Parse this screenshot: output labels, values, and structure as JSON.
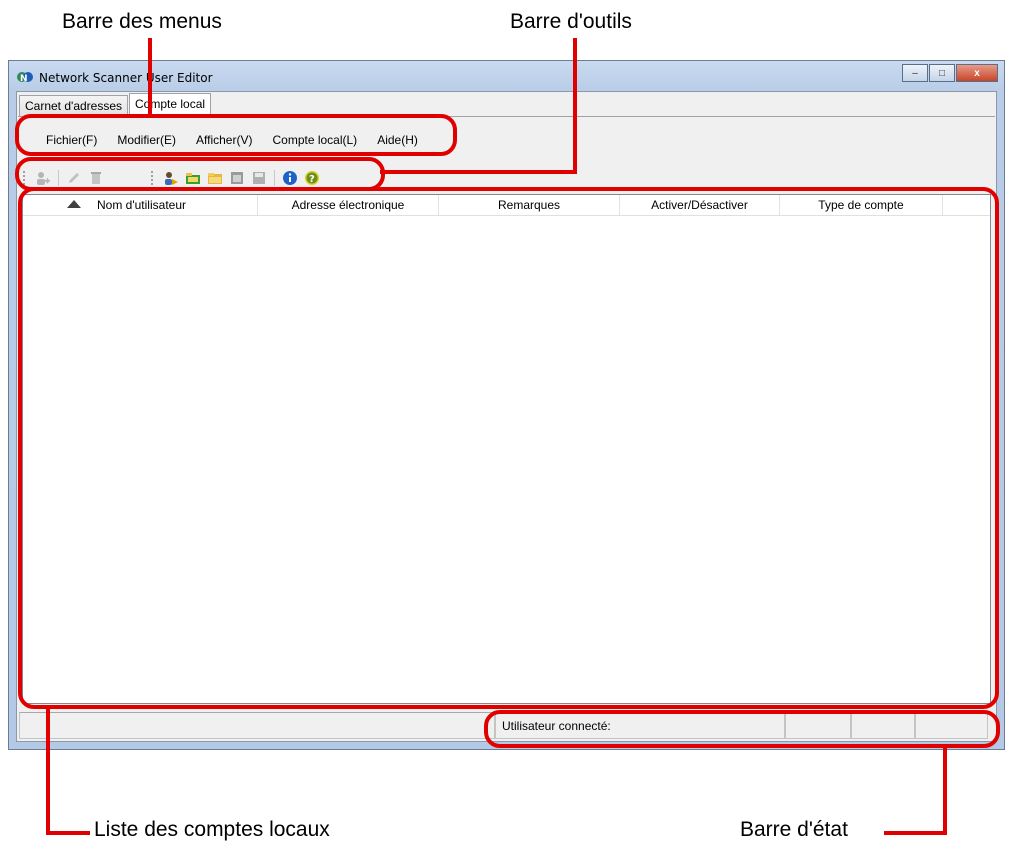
{
  "callouts": {
    "menubar": "Barre des menus",
    "toolbar": "Barre d'outils",
    "list": "Liste des comptes locaux",
    "statusbar": "Barre d'état"
  },
  "window": {
    "title": "Network Scanner User Editor",
    "minimize": "–",
    "maximize": "□",
    "close": "x"
  },
  "tabs": [
    {
      "label": "Carnet d'adresses"
    },
    {
      "label": "Compte local"
    }
  ],
  "menu": [
    {
      "label": "Fichier(F)"
    },
    {
      "label": "Modifier(E)"
    },
    {
      "label": "Afficher(V)"
    },
    {
      "label": "Compte local(L)"
    },
    {
      "label": "Aide(H)"
    }
  ],
  "toolbar": {
    "icons": [
      "add-user-icon",
      "edit-icon",
      "delete-icon",
      "import-icon",
      "open-icon",
      "folder-icon",
      "window-icon",
      "save-icon",
      "info-icon",
      "help-icon"
    ]
  },
  "list": {
    "columns": [
      {
        "label": "Nom d'utilisateur"
      },
      {
        "label": "Adresse électronique"
      },
      {
        "label": "Remarques"
      },
      {
        "label": "Activer/Désactiver"
      },
      {
        "label": "Type de compte"
      }
    ],
    "sort": "ascending"
  },
  "statusbar": {
    "user_label": "Utilisateur connecté:"
  },
  "colors": {
    "annotation": "#e00000"
  }
}
